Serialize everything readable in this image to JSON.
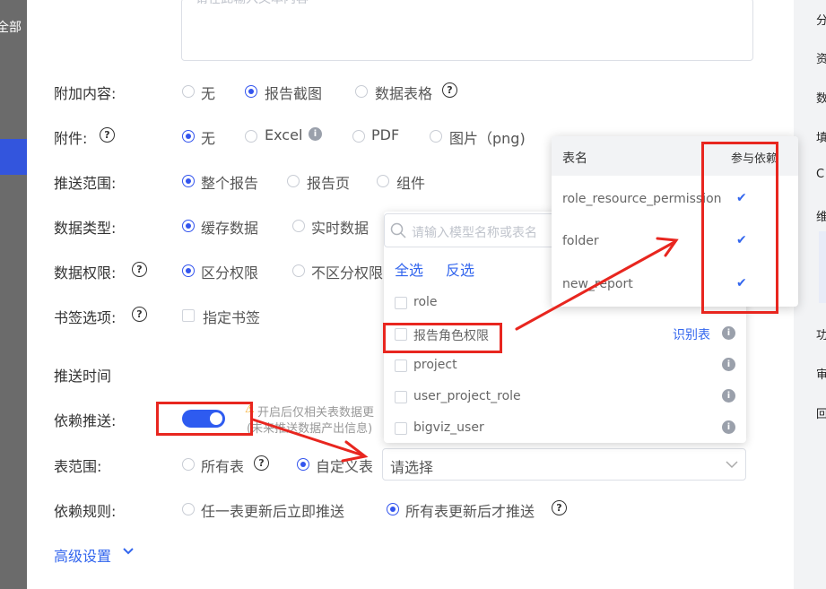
{
  "left_sidebar": {
    "label": "全部"
  },
  "right_sidebar": {
    "items": [
      "分",
      "资",
      "数",
      "填",
      "C",
      "维",
      "功",
      "审",
      "回"
    ]
  },
  "textarea": {
    "placeholder": "请在此输入文本内容"
  },
  "form": {
    "attach_content": {
      "label": "附加内容:",
      "options": [
        "无",
        "报告截图",
        "数据表格"
      ]
    },
    "attachment": {
      "label": "附件:",
      "options": [
        "无",
        "Excel",
        "PDF",
        "图片（png)"
      ]
    },
    "push_scope": {
      "label": "推送范围:",
      "options": [
        "整个报告",
        "报告页",
        "组件"
      ]
    },
    "data_type": {
      "label": "数据类型:",
      "options": [
        "缓存数据",
        "实时数据"
      ]
    },
    "data_permission": {
      "label": "数据权限:",
      "options": [
        "区分权限",
        "不区分权限"
      ]
    },
    "bookmark": {
      "label": "书签选项:",
      "option": "指定书签"
    },
    "push_time": {
      "label": "推送时间"
    },
    "depend_push": {
      "label": "依赖推送:",
      "hint_line1": "开启后仅相关表数据更",
      "hint_line2": "(未来推送数据产出信息)"
    },
    "table_scope": {
      "label": "表范围:",
      "options": [
        "所有表",
        "自定义表"
      ],
      "select_placeholder": "请选择"
    },
    "depend_rule": {
      "label": "依赖规则:",
      "options": [
        "任一表更新后立即推送",
        "所有表更新后才推送"
      ]
    },
    "advanced": {
      "label": "高级设置"
    }
  },
  "dropdown": {
    "search_placeholder": "请输入模型名称或表名",
    "select_all": "全选",
    "invert": "反选",
    "items": [
      "role",
      "报告角色权限",
      "project",
      "user_project_role",
      "bigviz_user"
    ],
    "identify": "识别表"
  },
  "popover": {
    "col_name": "表名",
    "col_dep": "参与依赖",
    "rows": [
      "role_resource_permission",
      "folder",
      "new_report"
    ]
  },
  "colors": {
    "accent": "#3355ee",
    "annotation_red": "#e8261f"
  }
}
